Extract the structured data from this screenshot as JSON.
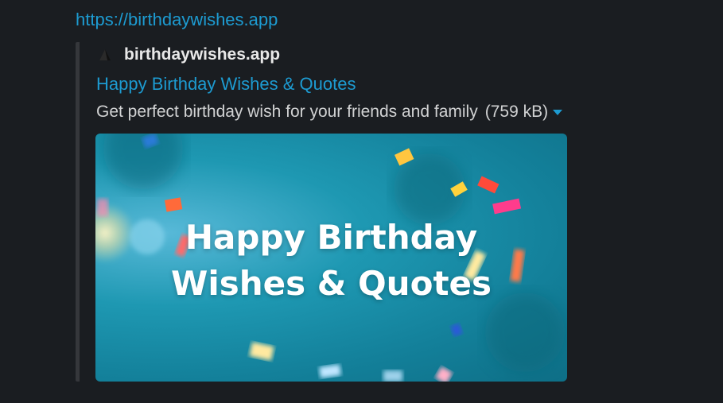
{
  "message": {
    "link_text": "https://birthdaywishes.app"
  },
  "unfurl": {
    "site_icon": "triangle-logo-icon",
    "site_name": "birthdaywishes.app",
    "title": "Happy Birthday Wishes & Quotes",
    "description": "Get perfect birthday wish for your friends and family",
    "file_size": "(759 kB)",
    "image": {
      "line1": "Happy Birthday",
      "line2": "Wishes & Quotes"
    }
  },
  "colors": {
    "background": "#1a1d21",
    "link": "#1d9bd1",
    "text": "#d1d2d3",
    "bar": "#35373b",
    "image_bg": "#13809a"
  }
}
